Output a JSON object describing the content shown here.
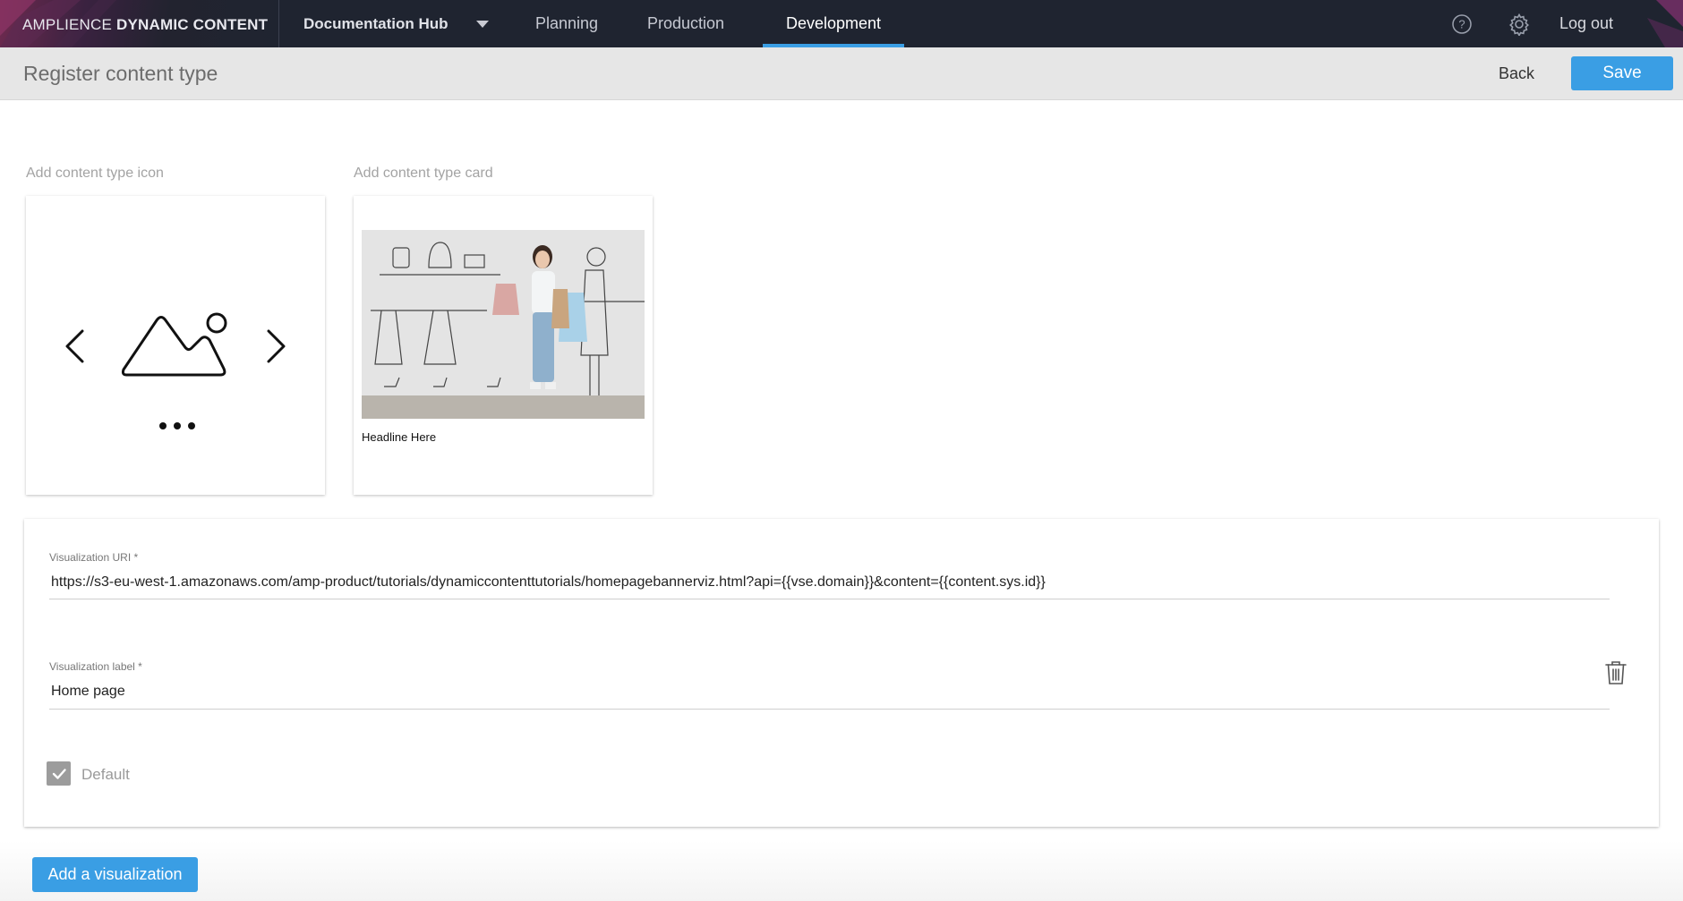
{
  "brand": {
    "prefix": "AMPLIENCE",
    "product": "DYNAMIC CONTENT"
  },
  "nav": {
    "hub": "Documentation Hub",
    "tabs": [
      {
        "label": "Planning",
        "active": false
      },
      {
        "label": "Production",
        "active": false
      },
      {
        "label": "Development",
        "active": true
      }
    ],
    "logout": "Log out"
  },
  "header": {
    "title": "Register content type",
    "back": "Back",
    "save": "Save"
  },
  "cards": {
    "icon_label": "Add content type icon",
    "card_label": "Add content type card",
    "card_headline": "Headline Here"
  },
  "visualization": {
    "uri_label": "Visualization URI *",
    "uri_value": "https://s3-eu-west-1.amazonaws.com/amp-product/tutorials/dynamiccontenttutorials/homepagebannerviz.html?api={{vse.domain}}&content={{content.sys.id}}",
    "label_label": "Visualization label *",
    "label_value": "Home page",
    "default_label": "Default",
    "default_checked": true
  },
  "add_visualization": "Add a visualization",
  "colors": {
    "accent": "#3a9ee4",
    "nav_bg": "#1f2430"
  },
  "icons": [
    "question-icon",
    "gear-icon",
    "chevron-left-icon",
    "chevron-right-icon",
    "image-placeholder-icon",
    "dots-icon",
    "trash-icon",
    "checkmark-icon"
  ]
}
